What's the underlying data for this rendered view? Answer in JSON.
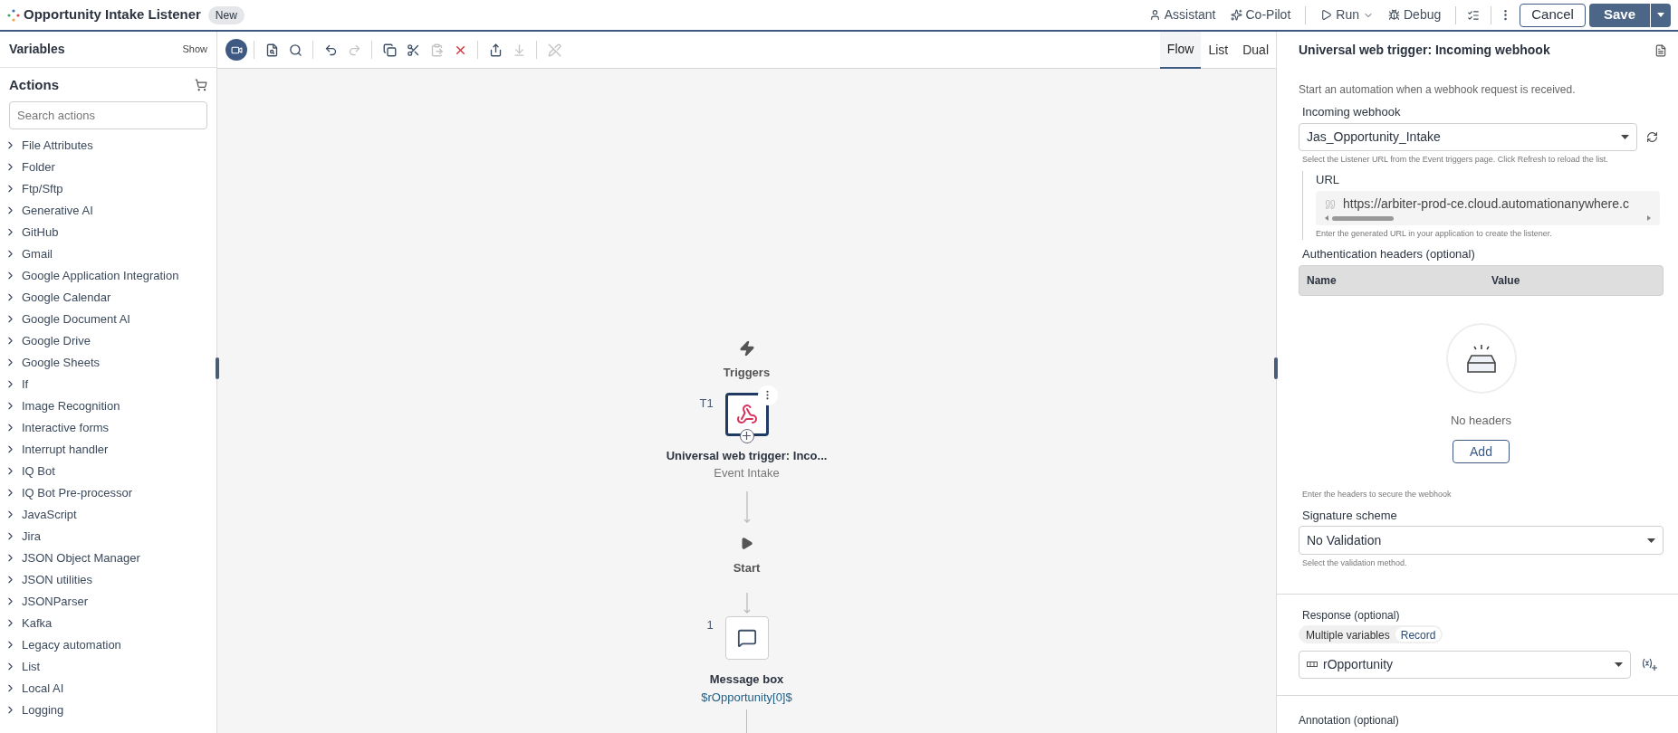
{
  "header": {
    "title": "Opportunity Intake Listener",
    "badge": "New",
    "actions": [
      {
        "kind": "assistant",
        "label": "Assistant"
      },
      {
        "kind": "copilot",
        "label": "Co-Pilot"
      },
      {
        "kind": "run",
        "label": "Run"
      },
      {
        "kind": "debug",
        "label": "Debug"
      }
    ],
    "cancel": "Cancel",
    "save": "Save"
  },
  "sidebar": {
    "variables_title": "Variables",
    "variables_toggle": "Show",
    "actions_title": "Actions",
    "search_placeholder": "Search actions",
    "items": [
      {
        "label": "File Attributes",
        "expanded": false
      },
      {
        "label": "Folder",
        "expanded": false
      },
      {
        "label": "Ftp/Sftp",
        "expanded": false
      },
      {
        "label": "Generative AI",
        "expanded": false
      },
      {
        "label": "GitHub",
        "expanded": false
      },
      {
        "label": "Gmail",
        "expanded": false
      },
      {
        "label": "Google Application Integration",
        "expanded": false
      },
      {
        "label": "Google Calendar",
        "expanded": false
      },
      {
        "label": "Google Document AI",
        "expanded": false
      },
      {
        "label": "Google Drive",
        "expanded": false
      },
      {
        "label": "Google Sheets",
        "expanded": false
      },
      {
        "label": "If",
        "expanded": false
      },
      {
        "label": "Image Recognition",
        "expanded": false
      },
      {
        "label": "Interactive forms",
        "expanded": false
      },
      {
        "label": "Interrupt handler",
        "expanded": false
      },
      {
        "label": "IQ Bot",
        "expanded": false
      },
      {
        "label": "IQ Bot Pre-processor",
        "expanded": false
      },
      {
        "label": "JavaScript",
        "expanded": false
      },
      {
        "label": "Jira",
        "expanded": false
      },
      {
        "label": "JSON Object Manager",
        "expanded": false
      },
      {
        "label": "JSON utilities",
        "expanded": false
      },
      {
        "label": "JSONParser",
        "expanded": false
      },
      {
        "label": "Kafka",
        "expanded": false
      },
      {
        "label": "Legacy automation",
        "expanded": false
      },
      {
        "label": "List",
        "expanded": false
      },
      {
        "label": "Local AI",
        "expanded": false
      },
      {
        "label": "Logging",
        "expanded": false
      }
    ]
  },
  "toolbar": {
    "groups": [
      [
        {
          "kind": "record",
          "on": true
        }
      ],
      [
        {
          "kind": "find",
          "disabled": false,
          "on": false
        },
        {
          "kind": "search",
          "disabled": false,
          "on": false
        }
      ],
      [
        {
          "kind": "undo",
          "disabled": false,
          "on": false
        },
        {
          "kind": "redo",
          "disabled": true,
          "on": false
        }
      ],
      [
        {
          "kind": "copy",
          "disabled": false,
          "on": false
        },
        {
          "kind": "cut",
          "disabled": false,
          "on": false
        },
        {
          "kind": "paste",
          "disabled": true,
          "on": false
        },
        {
          "kind": "delete",
          "disabled": false,
          "on": false
        }
      ],
      [
        {
          "kind": "export",
          "disabled": false,
          "on": false
        },
        {
          "kind": "import",
          "disabled": true,
          "on": false
        }
      ],
      [
        {
          "kind": "disable",
          "disabled": true,
          "on": false
        }
      ]
    ],
    "views": [
      {
        "label": "Flow",
        "selected": true
      },
      {
        "label": "List",
        "selected": false
      },
      {
        "label": "Dual",
        "selected": false
      }
    ]
  },
  "canvas": {
    "triggers_label": "Triggers",
    "trigger": {
      "index": "T1",
      "title": "Universal web trigger: Inco...",
      "subtitle": "Event Intake"
    },
    "start_label": "Start",
    "step": {
      "index": "1",
      "title": "Message box",
      "subtitle": "$rOpportunity[0]$"
    }
  },
  "panel": {
    "title": "Universal web trigger: Incoming webhook",
    "description": "Start an automation when a webhook request is received.",
    "webhook": {
      "label": "Incoming webhook",
      "value": "Jas_Opportunity_Intake",
      "hint": "Select the Listener URL from the Event triggers page. Click Refresh to reload the list."
    },
    "url": {
      "label": "URL",
      "value": "https://arbiter-prod-ce.cloud.automationanywhere.c",
      "hint": "Enter the generated URL in your application to create the listener."
    },
    "auth": {
      "label": "Authentication headers (optional)",
      "columns": [
        "Name",
        "Value"
      ],
      "empty": "No headers",
      "add": "Add",
      "hint": "Enter the headers to secure the webhook"
    },
    "signature": {
      "label": "Signature scheme",
      "value": "No Validation",
      "hint": "Select the validation method."
    },
    "response": {
      "label": "Response (optional)",
      "modes": [
        {
          "label": "Multiple variables",
          "selected": false
        },
        {
          "label": "Record",
          "selected": true
        }
      ],
      "value": "rOpportunity"
    },
    "annotation": {
      "label": "Annotation (optional)"
    }
  }
}
